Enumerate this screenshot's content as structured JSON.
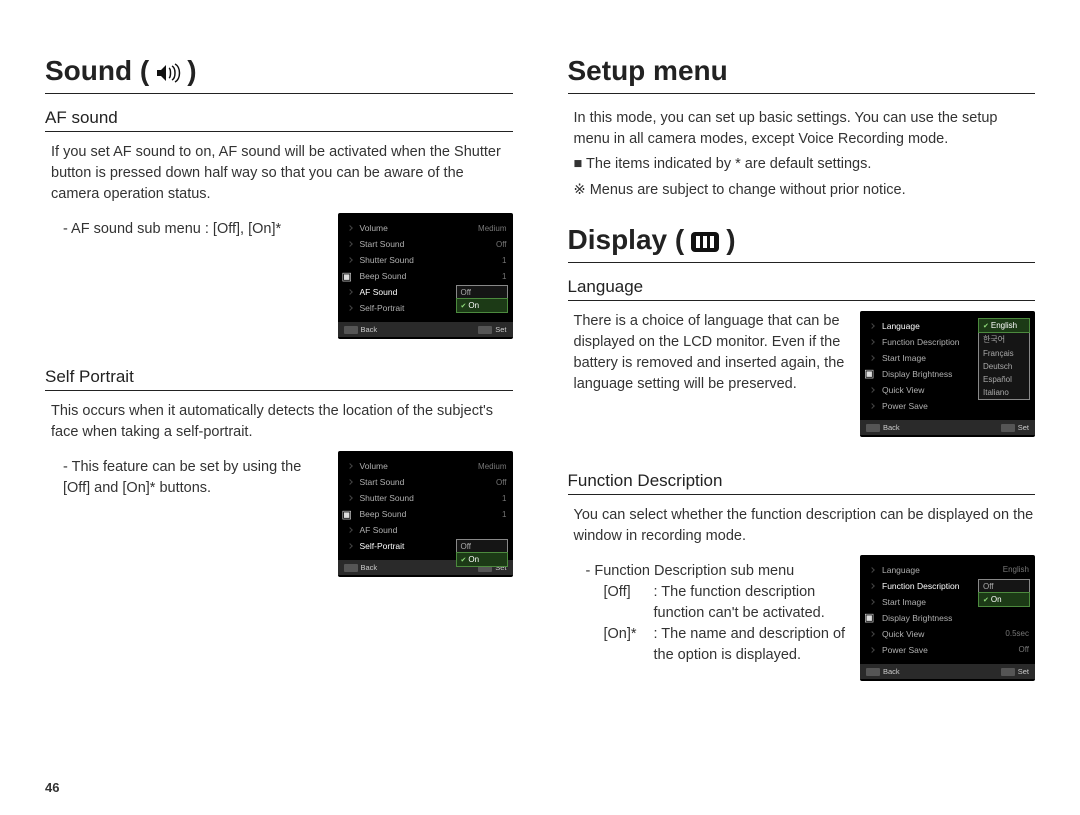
{
  "page_number": "46",
  "left": {
    "heading": "Sound (",
    "heading_close": ")",
    "icon": "sound-icon",
    "af": {
      "title": "AF sound",
      "body": "If you set AF sound to on, AF sound will be activated when the Shutter button is pressed down half way so that you can be aware of the camera operation status.",
      "submenu": "- AF sound sub menu : [Off], [On]*",
      "lcd": {
        "rows": [
          {
            "label": "Volume",
            "value": "Medium"
          },
          {
            "label": "Start Sound",
            "value": "Off"
          },
          {
            "label": "Shutter Sound",
            "value": "1"
          },
          {
            "label": "Beep Sound",
            "value": "1",
            "icon": true
          },
          {
            "label": "AF Sound",
            "value": "",
            "active": true
          },
          {
            "label": "Self-Portrait",
            "value": ""
          }
        ],
        "options": [
          "Off",
          "On"
        ],
        "selected": "On",
        "foot_back": "Back",
        "foot_set": "Set"
      }
    },
    "sp": {
      "title": "Self Portrait",
      "body": "This occurs when it automatically detects the location of the subject's face when taking a self-portrait.",
      "submenu": "- This feature can be set by using the [Off] and [On]* buttons.",
      "lcd": {
        "rows": [
          {
            "label": "Volume",
            "value": "Medium"
          },
          {
            "label": "Start Sound",
            "value": "Off"
          },
          {
            "label": "Shutter Sound",
            "value": "1"
          },
          {
            "label": "Beep Sound",
            "value": "1",
            "icon": true
          },
          {
            "label": "AF Sound",
            "value": ""
          },
          {
            "label": "Self-Portrait",
            "value": "",
            "active": true
          }
        ],
        "options": [
          "Off",
          "On"
        ],
        "selected": "On",
        "foot_back": "Back",
        "foot_set": "Set"
      }
    }
  },
  "right": {
    "setup": {
      "heading": "Setup menu",
      "body": "In this mode, you can set up basic settings. You can use the setup menu in all camera modes, except Voice Recording mode.",
      "bullet1_prefix": "■ ",
      "bullet1": "The items indicated by * are default settings.",
      "bullet2_prefix": "※ ",
      "bullet2": "Menus are subject to change without prior notice."
    },
    "display": {
      "heading": "Display (",
      "heading_close": ")",
      "icon": "display-icon",
      "lang": {
        "title": "Language",
        "body": "There is a choice of language that can be displayed on the LCD monitor. Even if the battery is removed and inserted again, the language setting will be preserved.",
        "lcd": {
          "rows": [
            {
              "label": "Language",
              "value": "",
              "active": true
            },
            {
              "label": "Function Description",
              "value": ""
            },
            {
              "label": "Start Image",
              "value": ""
            },
            {
              "label": "Display Brightness",
              "value": "",
              "icon": true
            },
            {
              "label": "Quick View",
              "value": ""
            },
            {
              "label": "Power Save",
              "value": ""
            }
          ],
          "options": [
            "English",
            "한국어",
            "Français",
            "Deutsch",
            "Español",
            "Italiano"
          ],
          "selected": "English",
          "foot_back": "Back",
          "foot_set": "Set"
        }
      },
      "fd": {
        "title": "Function Description",
        "body": "You can select whether the function description can be displayed on the window in recording mode.",
        "submenu": "- Function Description sub menu",
        "opt_off_label": "[Off]",
        "opt_off_text": ": The function description function can't be activated.",
        "opt_on_label": "[On]*",
        "opt_on_text": ": The name and description of the option is displayed.",
        "lcd": {
          "rows": [
            {
              "label": "Language",
              "value": "English"
            },
            {
              "label": "Function Description",
              "value": "",
              "active": true
            },
            {
              "label": "Start Image",
              "value": ""
            },
            {
              "label": "Display Brightness",
              "value": "",
              "icon": true
            },
            {
              "label": "Quick View",
              "value": "0.5sec"
            },
            {
              "label": "Power Save",
              "value": "Off"
            }
          ],
          "options": [
            "Off",
            "On"
          ],
          "selected": "On",
          "foot_back": "Back",
          "foot_set": "Set"
        }
      }
    }
  }
}
